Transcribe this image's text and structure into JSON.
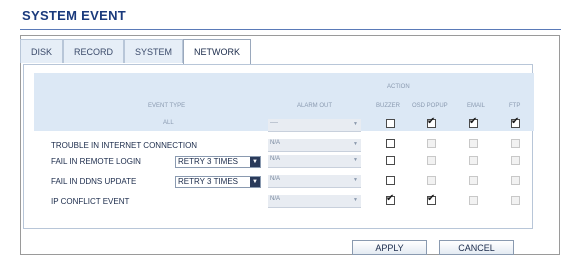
{
  "title": "SYSTEM EVENT",
  "tabs": [
    {
      "label": "DISK"
    },
    {
      "label": "RECORD"
    },
    {
      "label": "SYSTEM"
    },
    {
      "label": "NETWORK"
    }
  ],
  "header": {
    "action": "ACTION",
    "event_type": "EVENT TYPE",
    "alarm_out": "ALARM OUT",
    "buzzer": "BUZZER",
    "osd_popup": "OSD POPUP",
    "email": "EMAIL",
    "ftp": "FTP",
    "all": "ALL",
    "all_alarm": "----"
  },
  "rows": [
    {
      "label": "TROUBLE IN INTERNET CONNECTION",
      "alarm": "N/A"
    },
    {
      "label": "FAIL IN REMOTE LOGIN",
      "retry": "RETRY 3 TIMES",
      "alarm": "N/A"
    },
    {
      "label": "FAIL IN DDNS UPDATE",
      "retry": "RETRY 3 TIMES",
      "alarm": "N/A"
    },
    {
      "label": "IP CONFLICT EVENT",
      "alarm": "N/A"
    }
  ],
  "buttons": {
    "apply": "APPLY",
    "cancel": "CANCEL"
  }
}
